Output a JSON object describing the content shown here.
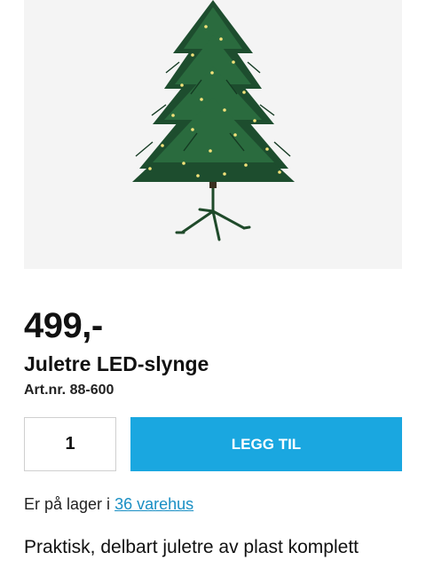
{
  "product": {
    "image_alt": "Juletre LED-slynge",
    "price": "499,-",
    "title": "Juletre LED-slynge",
    "article_number": "Art.nr. 88-600"
  },
  "purchase": {
    "quantity": "1",
    "add_button_label": "LEGG TIL",
    "accent_color": "#1aa7e0"
  },
  "stock": {
    "prefix": "Er på lager i",
    "link_text": "36 varehus"
  },
  "description": {
    "first_line": "Praktisk, delbart juletre av plast komplett"
  }
}
